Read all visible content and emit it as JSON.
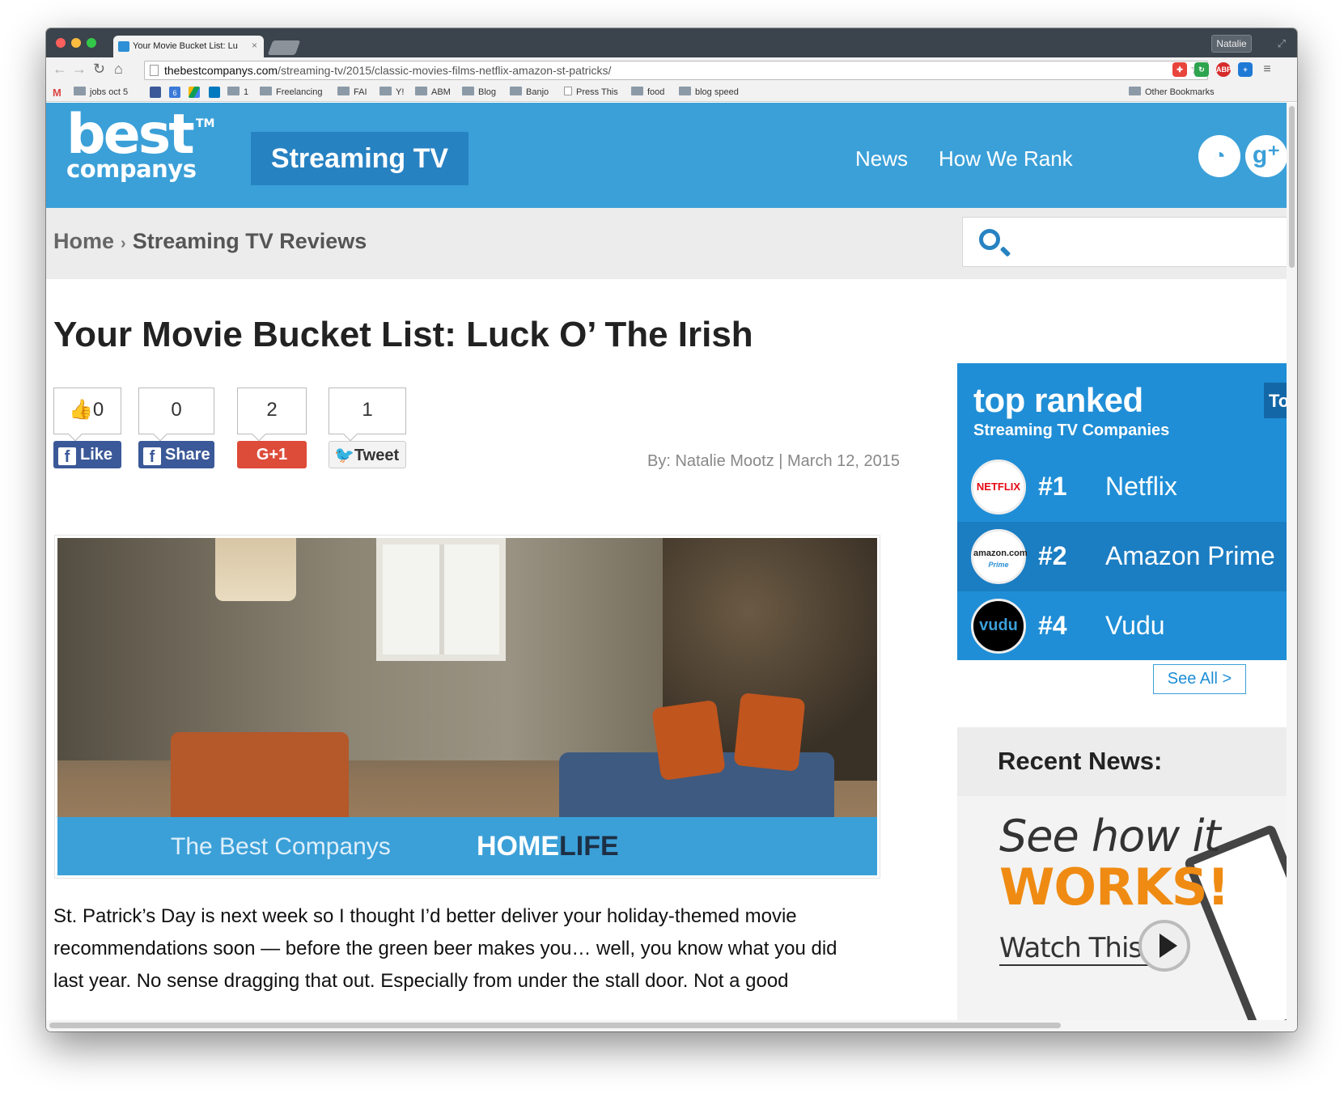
{
  "browser": {
    "tab_title": "Your Movie Bucket List: Lu",
    "tab_close": "×",
    "profile": "Natalie",
    "url_domain": "thebestcompanys.com",
    "url_path": "/streaming-tv/2015/classic-movies-films-netflix-amazon-st-patricks/",
    "bookmarks": [
      "jobs oct 5",
      "1",
      "Freelancing",
      "FAI",
      "Y!",
      "ABM",
      "Blog",
      "Banjo",
      "Press This",
      "food",
      "blog speed"
    ],
    "other_bookmarks": "Other Bookmarks",
    "badge_calendar": "6",
    "ext_abp": "ABP"
  },
  "header": {
    "logo_line1": "best",
    "logo_line2": "companys",
    "logo_tm": "TM",
    "category": "Streaming TV",
    "nav": [
      "News",
      "How We Rank"
    ],
    "social": [
      "rss-icon",
      "google-plus-icon"
    ],
    "gplus_glyph": "g⁺"
  },
  "breadcrumb": {
    "home": "Home",
    "sep": "›",
    "current": "Streaming TV Reviews"
  },
  "search": {
    "placeholder": ""
  },
  "article": {
    "title": "Your Movie Bucket List: Luck O’ The Irish",
    "counts": {
      "like": "0",
      "share": "0",
      "gplus": "2",
      "tweet": "1"
    },
    "buttons": {
      "like": "Like",
      "share": "Share",
      "gplus": "G+1",
      "tweet": "Tweet"
    },
    "byline": "By: Natalie Mootz  |  March 12, 2015",
    "hero_banner_left": "The Best Companys",
    "hero_banner_home": "HOME",
    "hero_banner_life": "LIFE",
    "body": "St. Patrick’s Day is next week so I thought I’d better deliver your holiday-themed movie recommendations soon — before the green beer makes you… well, you know what you did last year. No sense dragging that out. Especially from under the stall door. Not a good"
  },
  "sidebar": {
    "top_ranked_title": "top ranked",
    "top_ranked_sub": "Streaming TV Companies",
    "tab_stub": "To",
    "items": [
      {
        "rank": "#1",
        "name": "Netflix",
        "logo": "NETFLIX",
        "color": "#1f8ed6"
      },
      {
        "rank": "#2",
        "name": "Amazon Prime",
        "logo": "amazon.com",
        "logo_sub": "Prime",
        "color": "#1b7dc2"
      },
      {
        "rank": "#4",
        "name": "Vudu",
        "logo": "vudu",
        "color": "#1f8ed6"
      }
    ],
    "see_all": "See All >",
    "recent_news": "Recent News:",
    "promo_line1": "See how it",
    "promo_line2": "WORKS!",
    "promo_line3": "Watch This!"
  },
  "colors": {
    "brand_blue": "#3ba0d8",
    "dark_blue": "#2782c2",
    "facebook": "#3b5998",
    "gplus": "#dd4b39",
    "promo_orange": "#ef8b13"
  }
}
